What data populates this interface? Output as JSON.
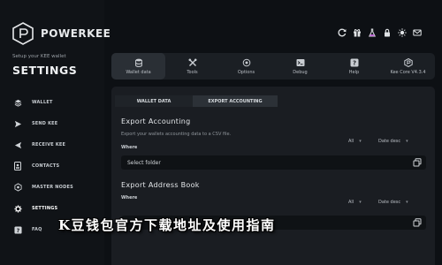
{
  "brand": {
    "name": "POWERKEE"
  },
  "sidebar": {
    "subtitle": "Setup your KEE wallet",
    "title": "SETTINGS",
    "items": [
      {
        "label": "WALLET",
        "icon": "layers-icon"
      },
      {
        "label": "SEND KEE",
        "icon": "send-icon"
      },
      {
        "label": "RECEIVE KEE",
        "icon": "receive-icon"
      },
      {
        "label": "CONTACTS",
        "icon": "contacts-icon"
      },
      {
        "label": "MASTER NODES",
        "icon": "nodes-icon"
      },
      {
        "label": "SETTINGS",
        "icon": "gear-icon",
        "active": true
      },
      {
        "label": "FAQ",
        "icon": "help-icon"
      }
    ]
  },
  "toolbar": {
    "icons": [
      "refresh-icon",
      "gift-icon",
      "flask-icon",
      "lock-icon",
      "sun-icon",
      "mail-icon"
    ]
  },
  "tabs": [
    {
      "label": "Wallet data",
      "icon": "database-icon",
      "active": true
    },
    {
      "label": "Tools",
      "icon": "tools-icon"
    },
    {
      "label": "Options",
      "icon": "options-icon"
    },
    {
      "label": "Debug",
      "icon": "terminal-icon"
    },
    {
      "label": "Help",
      "icon": "help-box-icon"
    },
    {
      "label": "Kee Core V4.3.4",
      "icon": "kee-core-icon"
    }
  ],
  "subtabs": [
    {
      "label": "WALLET DATA"
    },
    {
      "label": "EXPORT ACCOUNTING",
      "active": true
    }
  ],
  "export_accounting": {
    "title": "Export Accounting",
    "description": "Export your wallets accounting data to a CSV file.",
    "where_label": "Where",
    "filter_value": "All",
    "sort_value": "Date desc",
    "folder_placeholder": "Select folder"
  },
  "export_address_book": {
    "title": "Export Address Book",
    "where_label": "Where",
    "filter_value": "All",
    "sort_value": "Date desc"
  },
  "banner_text": "K豆钱包官方下载地址及使用指南",
  "colors": {
    "background": "#0d1014",
    "panel": "#1a1d22",
    "tabbar": "#1b1f24",
    "input": "#0f1215"
  }
}
